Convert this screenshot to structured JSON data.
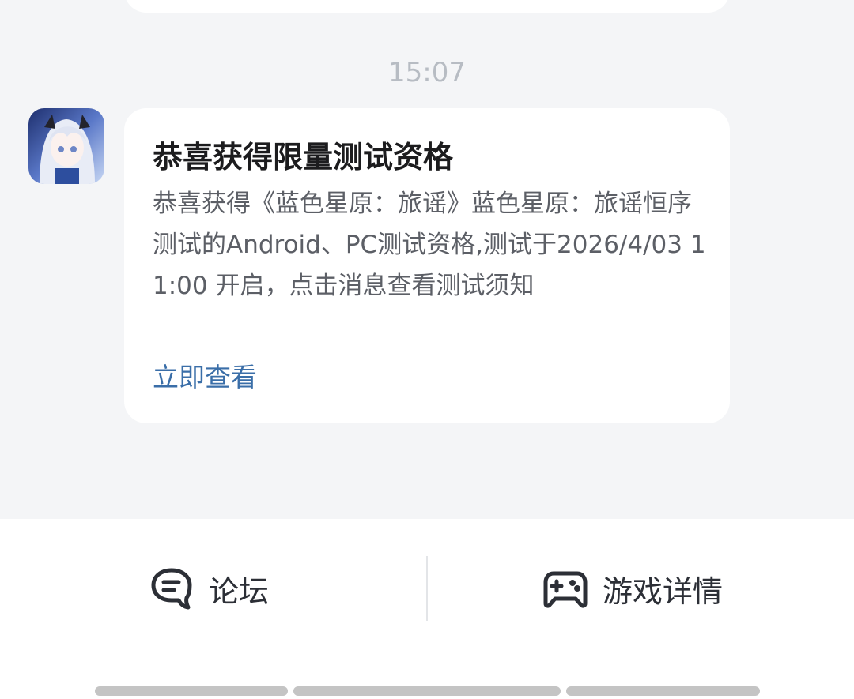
{
  "timestamp": "15:07",
  "message": {
    "title": "恭喜获得限量测试资格",
    "body": "恭喜获得《蓝色星原：旅谣》蓝色星原：旅谣恒序测试的Android、PC测试资格,测试于2026/4/03 11:00 开启，点击消息查看测试须知",
    "link": "立即查看"
  },
  "bottom_bar": {
    "forum_label": "论坛",
    "game_label": "游戏详情"
  },
  "colors": {
    "background": "#f4f5f7",
    "card": "#ffffff",
    "link": "#3a6ea8",
    "timestamp": "#b7bcc3"
  },
  "icons": [
    "game-avatar-icon",
    "forum-chat-icon",
    "gamepad-icon"
  ]
}
